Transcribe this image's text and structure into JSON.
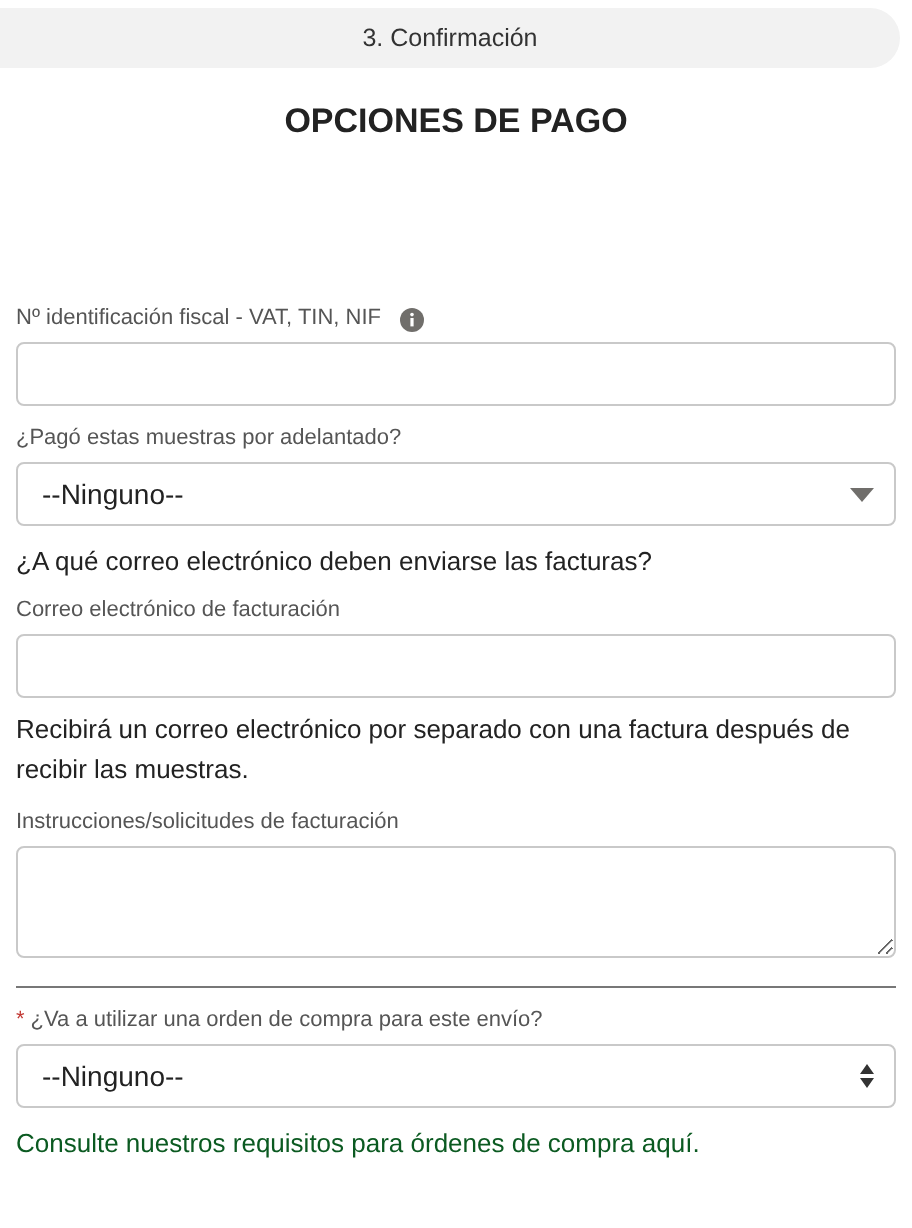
{
  "step": {
    "label": "3. Confirmación"
  },
  "title": "OPCIONES DE PAGO",
  "items": [
    {
      "kind": "input",
      "label": "Nº identificación fiscal - VAT, TIN, NIF",
      "info": true
    },
    {
      "kind": "select",
      "label": "¿Pagó estas muestras por adelantado?",
      "value": "--Ninguno--"
    },
    {
      "kind": "question",
      "text": "¿A qué correo electrónico deben enviarse las facturas?"
    },
    {
      "kind": "input",
      "label": "Correo electrónico de facturación"
    },
    {
      "kind": "note",
      "text": "Recibirá un correo electrónico por separado con una factura después de recibir las muestras."
    },
    {
      "kind": "textarea",
      "label": "Instrucciones/solicitudes de facturación"
    },
    {
      "kind": "divider"
    },
    {
      "kind": "listbox",
      "label": "¿Va a utilizar una orden de compra para este envío?",
      "value": "--Ninguno--",
      "mark": "*"
    },
    {
      "kind": "link",
      "text": "Consulte nuestros requisitos para órdenes de compra aquí."
    }
  ]
}
